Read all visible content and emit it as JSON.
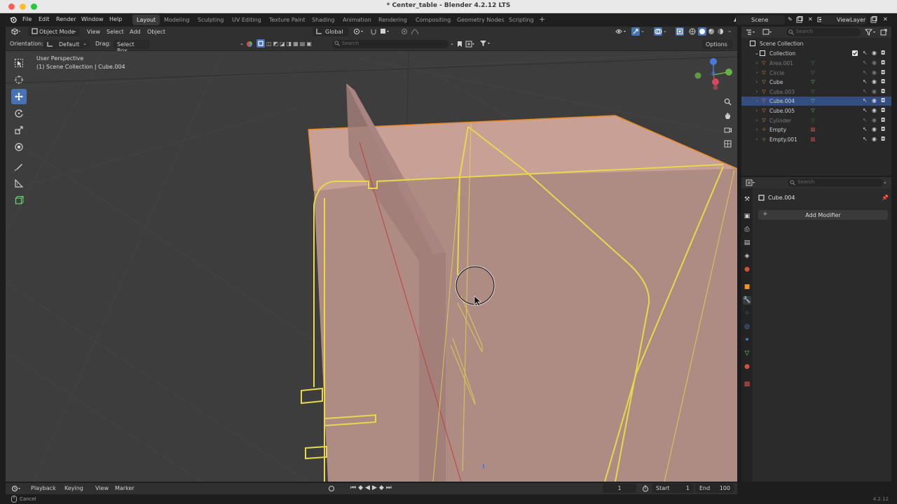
{
  "window": {
    "title": "* Center_table - Blender 4.2.12 LTS"
  },
  "menu": {
    "items": [
      "File",
      "Edit",
      "Render",
      "Window",
      "Help"
    ],
    "workspaces": [
      "Layout",
      "Modeling",
      "Sculpting",
      "UV Editing",
      "Texture Paint",
      "Shading",
      "Animation",
      "Rendering",
      "Compositing",
      "Geometry Nodes",
      "Scripting"
    ],
    "active_workspace": "Layout",
    "add_tab": "+",
    "scene": "Scene",
    "view_layer": "ViewLayer"
  },
  "viewport_header": {
    "mode": "Object Mode",
    "menus": [
      "View",
      "Select",
      "Add",
      "Object"
    ],
    "transform_orientation": "Global",
    "options": "Options"
  },
  "tool_header": {
    "orientation_label": "Orientation:",
    "orientation_value": "Default",
    "drag_label": "Drag:",
    "drag_value": "Select Box",
    "search_placeholder": "Search"
  },
  "viewport": {
    "perspective": "User Perspective",
    "context": "(1) Scene Collection | Cube.004"
  },
  "outliner": {
    "search_placeholder": "Search",
    "root": "Scene Collection",
    "collection": "Collection",
    "items": [
      {
        "name": "Area.001",
        "dim": true,
        "selected": false
      },
      {
        "name": "Circle",
        "dim": true,
        "selected": false
      },
      {
        "name": "Cube",
        "dim": false,
        "selected": false
      },
      {
        "name": "Cube.003",
        "dim": true,
        "selected": false
      },
      {
        "name": "Cube.004",
        "dim": false,
        "selected": true
      },
      {
        "name": "Cube.005",
        "dim": false,
        "selected": false
      },
      {
        "name": "Cylinder",
        "dim": true,
        "selected": false
      },
      {
        "name": "Empty",
        "dim": false,
        "selected": false
      },
      {
        "name": "Empty.001",
        "dim": false,
        "selected": false
      }
    ]
  },
  "properties": {
    "search_placeholder": "Search",
    "object_name": "Cube.004",
    "add_modifier": "Add Modifier"
  },
  "timeline": {
    "menus": [
      "Playback",
      "Keying",
      "View",
      "Marker"
    ],
    "current_frame": "1",
    "start_label": "Start",
    "start_value": "1",
    "end_label": "End",
    "end_value": "100"
  },
  "status": {
    "left": "Cancel",
    "version": "4.2.12"
  },
  "colors": {
    "accent": "#4772b3",
    "selection_outline": "#e8d84a",
    "object_fill": "#c89b8c",
    "viewport_bg": "#3d3d3d"
  }
}
